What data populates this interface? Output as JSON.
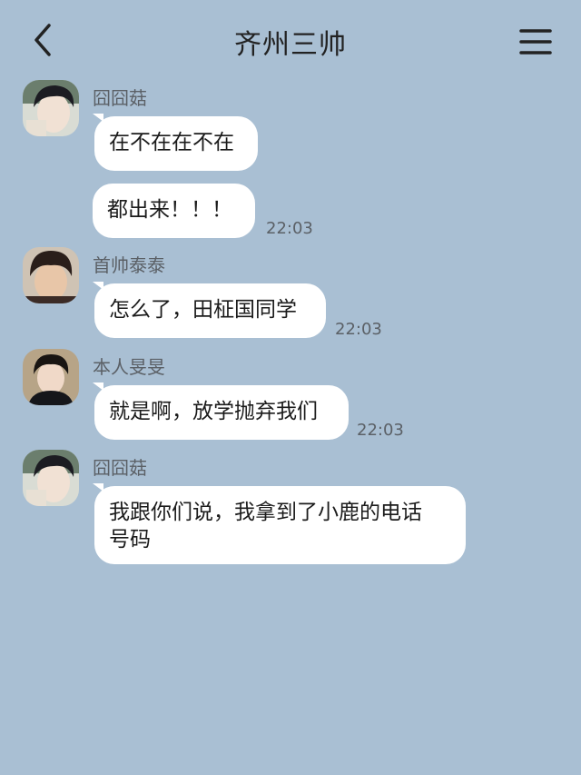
{
  "header": {
    "title": "齐州三帅"
  },
  "icons": {
    "back": "chevron-left-icon",
    "menu": "hamburger-menu-icon"
  },
  "colors": {
    "background": "#a9bfd3",
    "bubble": "#ffffff",
    "name_text": "#5b6066"
  },
  "messages": [
    {
      "sender": "囧囧菇",
      "text": "在不在在不在",
      "time": ""
    },
    {
      "sender": "",
      "text": "都出来！！！",
      "time": "22:03"
    },
    {
      "sender": "首帅泰泰",
      "text": "怎么了，田柾国同学",
      "time": "22:03"
    },
    {
      "sender": "本人旻旻",
      "text": "就是啊，放学抛弃我们",
      "time": "22:03"
    },
    {
      "sender": "囧囧菇",
      "text": "我跟你们说，我拿到了小鹿的电话\n号码",
      "time": ""
    }
  ]
}
